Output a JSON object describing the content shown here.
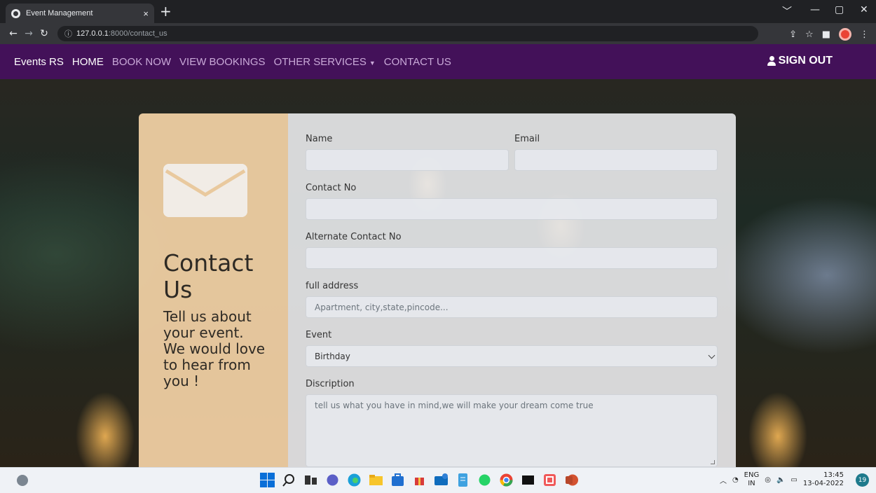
{
  "browser": {
    "tab_title": "Event Management",
    "tab_close": "×",
    "new_tab": "+",
    "url_host": "127.0.0.1",
    "url_path": ":8000/contact_us",
    "window_controls": [
      "﹀",
      "—",
      "▢",
      "✕"
    ]
  },
  "navbar": {
    "brand": "Events RS",
    "items": [
      {
        "label": "HOME",
        "active": true
      },
      {
        "label": "BOOK NOW",
        "active": false
      },
      {
        "label": "VIEW BOOKINGS",
        "active": false
      },
      {
        "label": "OTHER SERVICES",
        "active": false,
        "dropdown": true
      },
      {
        "label": "CONTACT US",
        "active": false
      }
    ],
    "signout": "SIGN OUT"
  },
  "contact": {
    "title": "Contact Us",
    "subtitle": "Tell us about your event. We would love to hear from you !"
  },
  "form": {
    "name_label": "Name",
    "name_value": "",
    "email_label": "Email",
    "email_value": "",
    "contact_label": "Contact No",
    "contact_value": "",
    "alt_contact_label": "Alternate Contact No",
    "alt_contact_value": "",
    "address_label": "full address",
    "address_placeholder": "Apartment, city,state,pincode...",
    "event_label": "Event",
    "event_selected": "Birthday",
    "description_label": "Discription",
    "description_placeholder": "tell us what you have in mind,we will make your dream come true"
  },
  "taskbar": {
    "lang_top": "ENG",
    "lang_bottom": "IN",
    "time": "13:45",
    "date": "13-04-2022",
    "notifications": "19"
  },
  "colors": {
    "navbar": "#460f5f",
    "left_panel": "#fad7aa",
    "chrome": "#35363a"
  }
}
